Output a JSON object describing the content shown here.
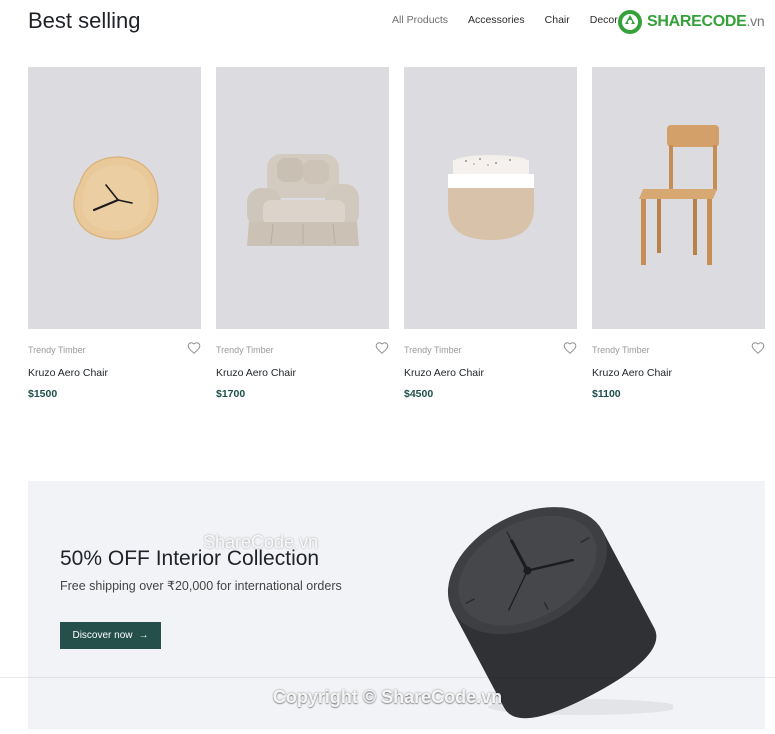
{
  "header": {
    "title": "Best selling",
    "tabs": [
      {
        "label": "All Products",
        "active": true
      },
      {
        "label": "Accessories",
        "active": false
      },
      {
        "label": "Chair",
        "active": false
      },
      {
        "label": "Decor",
        "active": false
      }
    ]
  },
  "watermark": {
    "logo_text": "SHARECODE",
    "logo_suffix": ".vn",
    "center_text": "ShareCode.vn",
    "copyright_text": "Copyright © ShareCode.vn"
  },
  "products": [
    {
      "brand": "Trendy Timber",
      "name": "Kruzo Aero Chair",
      "price": "$1500",
      "image_icon": "wall-clock-icon"
    },
    {
      "brand": "Trendy Timber",
      "name": "Kruzo Aero Chair",
      "price": "$1700",
      "image_icon": "armchair-icon"
    },
    {
      "brand": "Trendy Timber",
      "name": "Kruzo Aero Chair",
      "price": "$4500",
      "image_icon": "planter-bowl-icon"
    },
    {
      "brand": "Trendy Timber",
      "name": "Kruzo Aero Chair",
      "price": "$1100",
      "image_icon": "wooden-chair-icon"
    }
  ],
  "promo": {
    "title": "50% OFF Interior Collection",
    "subtitle": "Free shipping over ₹20,000 for international orders",
    "button_label": "Discover now",
    "button_arrow": "→"
  },
  "colors": {
    "accent": "#244f4b",
    "price": "#1e4f4a",
    "card_bg": "#dcdce0",
    "promo_bg": "#f2f3f6",
    "logo_green": "#35a13a"
  }
}
